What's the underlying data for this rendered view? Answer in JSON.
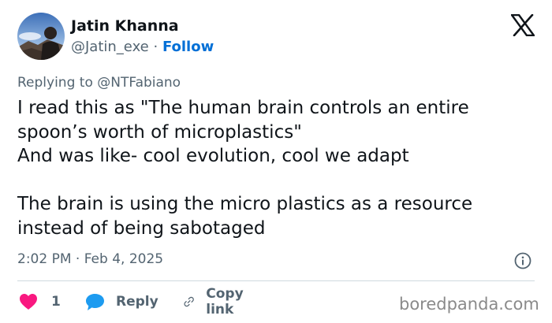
{
  "author": {
    "display_name": "Jatin Khanna",
    "handle": "@Jatin_exe",
    "separator": "·",
    "follow_label": "Follow"
  },
  "replying_to": "Replying to @NTFabiano",
  "tweet": {
    "paragraphs": [
      "I read this as \"The human brain controls an entire spoon’s worth of microplastics\"\nAnd was like- cool evolution, cool we adapt",
      "The brain is using the micro plastics as a resource instead of being sabotaged"
    ]
  },
  "timestamp": "2:02 PM · Feb 4, 2025",
  "actions": {
    "like_count": "1",
    "reply_label": "Reply",
    "copy_link_label": "Copy link"
  },
  "watermark": "boredpanda.com",
  "icons": {
    "logo": "x-logo-icon",
    "info": "info-icon",
    "like": "heart-icon",
    "reply": "speech-bubble-icon",
    "copy": "link-icon"
  },
  "colors": {
    "text": "#0f1419",
    "muted": "#536471",
    "follow": "#006fd6",
    "heart": "#f91880",
    "reply_bubble": "#1d9bf0",
    "divider": "#cfd9de"
  }
}
